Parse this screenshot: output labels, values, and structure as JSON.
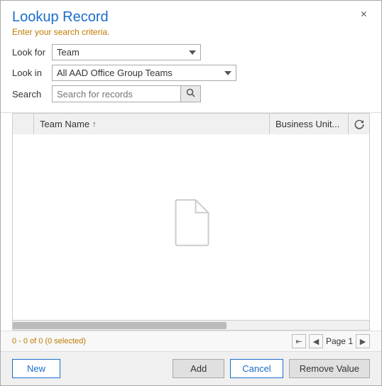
{
  "dialog": {
    "title": "Lookup Record",
    "subtitle": "Enter your search criteria.",
    "close_label": "×"
  },
  "form": {
    "look_for_label": "Look for",
    "look_in_label": "Look in",
    "search_label": "Search",
    "look_for_value": "Team",
    "look_in_value": "All AAD Office Group Teams",
    "search_placeholder": "Search for records",
    "look_for_options": [
      "Team"
    ],
    "look_in_options": [
      "All AAD Office Group Teams"
    ]
  },
  "table": {
    "col_team_name": "Team Name",
    "col_business_unit": "Business Unit...",
    "sort_icon": "↑",
    "rows": []
  },
  "status": {
    "text": "0 - 0 of 0 (0 selected)",
    "page_label": "Page 1"
  },
  "footer": {
    "new_label": "New",
    "add_label": "Add",
    "cancel_label": "Cancel",
    "remove_label": "Remove Value"
  }
}
